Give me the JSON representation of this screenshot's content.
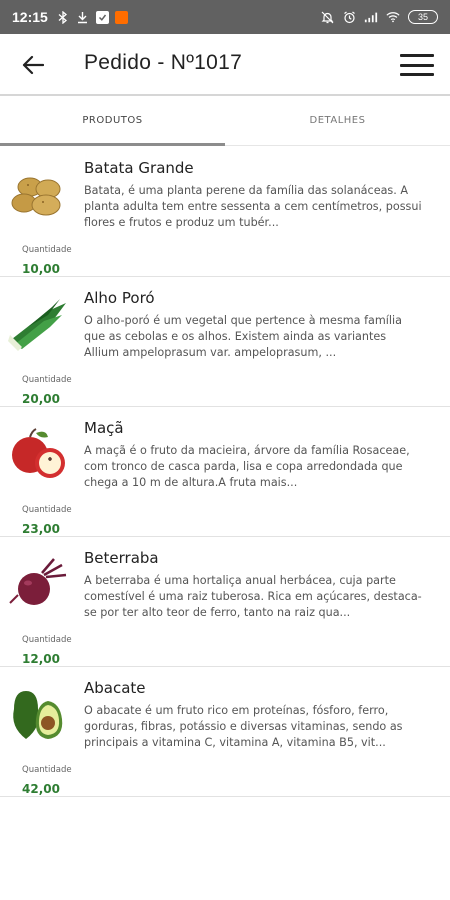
{
  "status_bar": {
    "time": "12:15",
    "battery": "35",
    "icons_left": [
      "bluetooth-icon",
      "download-icon",
      "check-icon",
      "orange-app-icon"
    ],
    "icons_right": [
      "mute-icon",
      "alarm-icon",
      "signal-icon",
      "wifi-icon",
      "battery-icon"
    ]
  },
  "app_bar": {
    "title": "Pedido - Nº1017"
  },
  "tabs": [
    {
      "label": "PRODUTOS",
      "active": true
    },
    {
      "label": "DETALHES",
      "active": false
    }
  ],
  "products": [
    {
      "name": "Batata Grande",
      "description": "Batata, é uma planta perene da família das solanáceas. A planta adulta tem entre sessenta a cem centímetros, possui flores e frutos e produz um tubér...",
      "quantity_label": "Quantidade",
      "quantity": "10,00",
      "icon": "potato-icon"
    },
    {
      "name": "Alho Poró",
      "description": "O alho-poró é um vegetal que pertence à mesma família que as cebolas e os alhos. Existem ainda as variantes Allium ampeloprasum var. ampeloprasum, ...",
      "quantity_label": "Quantidade",
      "quantity": "20,00",
      "icon": "leek-icon"
    },
    {
      "name": "Maçã",
      "description": "A maçã é o fruto da macieira, árvore da família Rosaceae, com tronco de casca parda, lisa e copa arredondada que chega a 10 m de altura.A fruta mais...",
      "quantity_label": "Quantidade",
      "quantity": "23,00",
      "icon": "apple-icon"
    },
    {
      "name": "Beterraba",
      "description": "A beterraba é uma hortaliça anual herbácea, cuja parte comestível é uma raiz tuberosa. Rica em açúcares, destaca-se por ter alto teor de ferro, tanto na raiz qua...",
      "quantity_label": "Quantidade",
      "quantity": "12,00",
      "icon": "beet-icon"
    },
    {
      "name": "Abacate",
      "description": "O abacate é um fruto rico em proteínas, fósforo, ferro, gorduras, fibras, potássio e diversas vitaminas, sendo as principais a vitamina C, vitamina A, vitamina B5, vit...",
      "quantity_label": "Quantidade",
      "quantity": "42,00",
      "icon": "avocado-icon"
    }
  ]
}
